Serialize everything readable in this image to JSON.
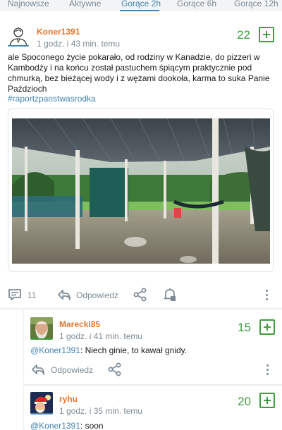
{
  "tabs": [
    {
      "label": "Najnowsze"
    },
    {
      "label": "Aktywne"
    },
    {
      "label": "Gorące 2h"
    },
    {
      "label": "Gorące 6h"
    },
    {
      "label": "Gorące 12h"
    }
  ],
  "active_tab": "Gorące 2h",
  "post": {
    "author": "Koner1391",
    "time": "1 godz. i 43 min. temu",
    "score": "22",
    "body": "ale Spoconego życie pokarało, od rodziny w Kanadzie, do pizzeri w Kambodży i na końcu został pastuchem śpiącym praktycznie pod chmurką, bez bieżącej wody i z wężami dookoła, karma to suka Panie Paździoch",
    "hashtag": "#raportzpanstwasrodka",
    "comment_count": "11",
    "reply_label": "Odpowiedz"
  },
  "comments": [
    {
      "author": "Marecki85",
      "time": "1 godz. i 41 min. temu",
      "score": "15",
      "mention": "@Koner1391",
      "text": ": Niech ginie, to kawał gnidy.",
      "reply_label": "Odpowiedz"
    },
    {
      "author": "ryhu",
      "time": "1 godz. i 35 min. temu",
      "score": "20",
      "mention": "@Koner1391",
      "text": ": soon"
    }
  ],
  "colors": {
    "accent_blue": "#4383af",
    "author_orange": "#e8762b",
    "vote_green": "#3f9e3f",
    "muted": "#7d8b96"
  }
}
